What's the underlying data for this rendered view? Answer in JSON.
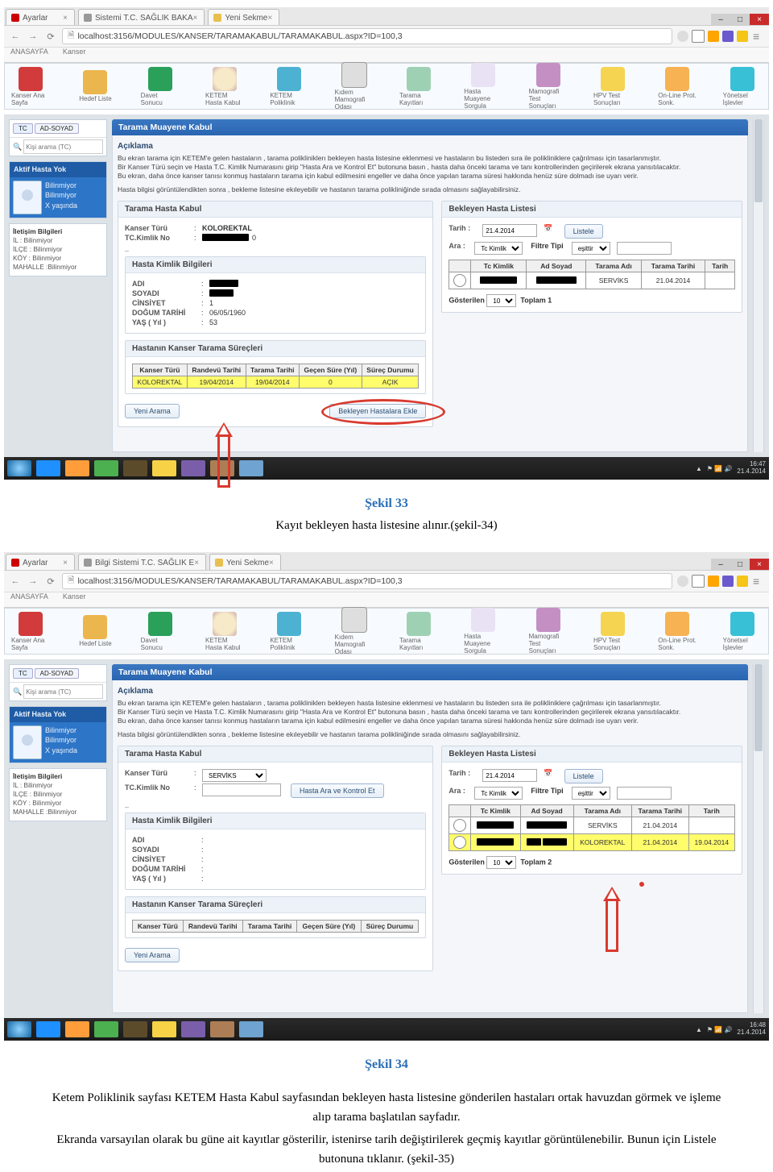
{
  "shot1": {
    "tabs": [
      "Ayarlar",
      "Sistemi T.C. SAĞLIK BAKA",
      "Yeni Sekme"
    ],
    "url": "localhost:3156/MODULES/KANSER/TARAMAKABUL/TARAMAKABUL.aspx?ID=100,3",
    "subtabs": [
      "ANASAYFA",
      "Kanser"
    ],
    "toolbar": [
      "Kanser Ana Sayfa",
      "Hedef Liste",
      "Davet Sonucu",
      "KETEM Hasta Kabul",
      "KETEM Poliklinik",
      "Kıdem Mamografi Odası",
      "Tarama Kayıtları",
      "Hasta Muayene Sorgula",
      "Mamografi Test Sonuçları",
      "HPV Test Sonuçları",
      "On-Line Prot. Sonk.",
      "Yönetsel İşlevler"
    ],
    "side": {
      "pill_tc": "TC",
      "pill_adsoyad": "AD-SOYAD",
      "search_ph": "Kişi arama (TC)",
      "blue_title": "Aktif Hasta Yok",
      "blue_lines": [
        "Bilinmiyor",
        "Bilinmiyor",
        "X yaşında"
      ],
      "info_title": "İletişim Bilgileri",
      "info_rows": [
        [
          "İL :",
          "Bilinmiyor"
        ],
        [
          "İLÇE :",
          "Bilinmiyor"
        ],
        [
          "KÖY :",
          "Bilinmiyor"
        ],
        [
          "MAHALLE :",
          "Bilinmiyor"
        ]
      ]
    },
    "panel_title": "Tarama Muayene Kabul",
    "aciklama_hd": "Açıklama",
    "aciklama": [
      "Bu ekran tarama için KETEM'e gelen hastaların , tarama polikliniklerı bekleyen hasta listesine eklenmesi ve hastaların bu listeden sıra ile polikliniklere çağrılması için tasarlanmıştır.",
      "Bir Kanser Türü seçin ve Hasta T.C. Kimlik Numarasını girip \"Hasta Ara ve Kontrol Et\" butonuna basın , hasta daha önceki tarama ve tanı kontrollerinden geçirilerek ekrana yansıtılacaktır.",
      "Bu ekran, daha önce kanser tanısı konmuş hastaların tarama için kabul edilmesini engeller ve daha önce yapılan tarama süresi hakkında henüz süre dolmadı ise uyarı verir.",
      "Hasta bilgisi görüntülendikten sonra , bekleme listesine ekıleyebilir ve hastanın tarama polikliniğinde sırada olmasını sağlayabilirsiniz."
    ],
    "left": {
      "card1_hd": "Tarama Hasta Kabul",
      "kanser_turu_l": "Kanser Türü",
      "kanser_turu_v": "KOLOREKTAL",
      "tckimlik_l": "TC.Kimlik No",
      "tckimlik_suffix": "0",
      "card2_hd": "Hasta Kimlik Bilgileri",
      "kimlik_rows": [
        [
          "ADI",
          ""
        ],
        [
          "SOYADI",
          ""
        ],
        [
          "CİNSİYET",
          "1"
        ],
        [
          "DOĞUM TARİHİ",
          "06/05/1960"
        ],
        [
          "YAŞ ( Yıl )",
          "53"
        ]
      ],
      "card3_hd": "Hastanın Kanser Tarama Süreçleri",
      "tbl_hd": [
        "Kanser Türü",
        "Randevü Tarihi",
        "Tarama Tarihi",
        "Geçen Süre (Yıl)",
        "Süreç Durumu"
      ],
      "tbl_row": [
        "KOLOREKTAL",
        "19/04/2014",
        "19/04/2014",
        "0",
        "AÇIK"
      ],
      "btn_yeni": "Yeni Arama",
      "btn_ekle": "Bekleyen Hastalara Ekle"
    },
    "right": {
      "card_hd": "Bekleyen Hasta Listesi",
      "tarih_l": "Tarih :",
      "tarih_v": "21.4.2014",
      "btn_listele": "Listele",
      "ara_l": "Ara :",
      "ara_sel": "Tc Kimlik",
      "filtre_l": "Filtre Tipi",
      "filtre_v": "eşittir",
      "cols": [
        "",
        "Tc Kimlik",
        "Ad Soyad",
        "Tarama Adı",
        "Tarama Tarihi",
        "Tarih"
      ],
      "row": [
        "",
        "",
        "",
        "SERVİKS",
        "21.04.2014",
        ""
      ],
      "gost_l": "Gösterilen",
      "gost_v": "10",
      "toplam_l": "Toplam 1"
    },
    "taskbar_clock": [
      "16:47",
      "21.4.2014"
    ]
  },
  "caption1": {
    "hd": "Şekil 33",
    "body": "Kayıt bekleyen hasta listesine alınır.(şekil-34)"
  },
  "shot2": {
    "tabs": [
      "Ayarlar",
      "Bilgi Sistemi T.C. SAĞLIK E",
      "Yeni Sekme"
    ],
    "url": "localhost:3156/MODULES/KANSER/TARAMAKABUL/TARAMAKABUL.aspx?ID=100,3",
    "subtabs": [
      "ANASAYFA",
      "Kanser"
    ],
    "left": {
      "kanser_turu_v": "SERVİKS",
      "btn_search": "Hasta Ara ve Kontrol Et",
      "kimlik_rows": [
        [
          "ADI",
          ""
        ],
        [
          "SOYADI",
          ""
        ],
        [
          "CİNSİYET",
          ""
        ],
        [
          "DOĞUM TARİHİ",
          ""
        ],
        [
          "YAŞ ( Yıl )",
          ""
        ]
      ]
    },
    "right": {
      "rows": [
        [
          "",
          "",
          "",
          "SERVİKS",
          "21.04.2014",
          ""
        ],
        [
          "",
          "",
          "",
          "KOLOREKTAL",
          "21.04.2014",
          "19.04.2014"
        ]
      ],
      "toplam": "Toplam 2"
    },
    "taskbar_clock": [
      "16:48",
      "21.4.2014"
    ]
  },
  "caption2": {
    "hd": "Şekil 34",
    "body1": "Ketem Poliklinik sayfası KETEM Hasta Kabul sayfasından bekleyen hasta listesine gönderilen hastaları ortak havuzdan görmek ve işleme alıp tarama başlatılan sayfadır.",
    "body2": "Ekranda varsayılan olarak bu güne ait kayıtlar gösterilir, istenirse tarih değiştirilerek geçmiş kayıtlar görüntülenebilir. Bunun için Listele butonuna tıklanır. (şekil-35)"
  }
}
